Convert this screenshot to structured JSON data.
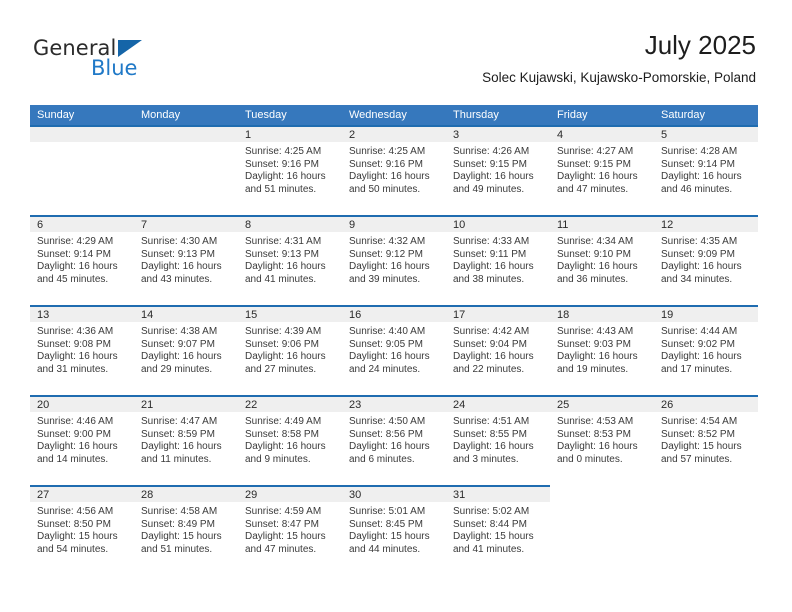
{
  "brand": {
    "name_top": "General",
    "name_bottom": "Blue",
    "accent_color": "#2079c7",
    "triangle_color": "#1565a8"
  },
  "header": {
    "title": "July 2025",
    "subtitle": "Solec Kujawski, Kujawsko-Pomorskie, Poland"
  },
  "theme": {
    "header_row_bg": "#3678bd",
    "row_separator": "#1f6cb0",
    "daynum_band_bg": "#efefef",
    "text_color": "#3a3a3a"
  },
  "weekdays": [
    "Sunday",
    "Monday",
    "Tuesday",
    "Wednesday",
    "Thursday",
    "Friday",
    "Saturday"
  ],
  "labels": {
    "sunrise": "Sunrise:",
    "sunset": "Sunset:",
    "daylight": "Daylight:"
  },
  "weeks": [
    [
      {
        "day": "",
        "empty": true
      },
      {
        "day": "",
        "empty": true
      },
      {
        "day": "1",
        "sunrise": "Sunrise: 4:25 AM",
        "sunset": "Sunset: 9:16 PM",
        "daylight": "Daylight: 16 hours and 51 minutes."
      },
      {
        "day": "2",
        "sunrise": "Sunrise: 4:25 AM",
        "sunset": "Sunset: 9:16 PM",
        "daylight": "Daylight: 16 hours and 50 minutes."
      },
      {
        "day": "3",
        "sunrise": "Sunrise: 4:26 AM",
        "sunset": "Sunset: 9:15 PM",
        "daylight": "Daylight: 16 hours and 49 minutes."
      },
      {
        "day": "4",
        "sunrise": "Sunrise: 4:27 AM",
        "sunset": "Sunset: 9:15 PM",
        "daylight": "Daylight: 16 hours and 47 minutes."
      },
      {
        "day": "5",
        "sunrise": "Sunrise: 4:28 AM",
        "sunset": "Sunset: 9:14 PM",
        "daylight": "Daylight: 16 hours and 46 minutes."
      }
    ],
    [
      {
        "day": "6",
        "sunrise": "Sunrise: 4:29 AM",
        "sunset": "Sunset: 9:14 PM",
        "daylight": "Daylight: 16 hours and 45 minutes."
      },
      {
        "day": "7",
        "sunrise": "Sunrise: 4:30 AM",
        "sunset": "Sunset: 9:13 PM",
        "daylight": "Daylight: 16 hours and 43 minutes."
      },
      {
        "day": "8",
        "sunrise": "Sunrise: 4:31 AM",
        "sunset": "Sunset: 9:13 PM",
        "daylight": "Daylight: 16 hours and 41 minutes."
      },
      {
        "day": "9",
        "sunrise": "Sunrise: 4:32 AM",
        "sunset": "Sunset: 9:12 PM",
        "daylight": "Daylight: 16 hours and 39 minutes."
      },
      {
        "day": "10",
        "sunrise": "Sunrise: 4:33 AM",
        "sunset": "Sunset: 9:11 PM",
        "daylight": "Daylight: 16 hours and 38 minutes."
      },
      {
        "day": "11",
        "sunrise": "Sunrise: 4:34 AM",
        "sunset": "Sunset: 9:10 PM",
        "daylight": "Daylight: 16 hours and 36 minutes."
      },
      {
        "day": "12",
        "sunrise": "Sunrise: 4:35 AM",
        "sunset": "Sunset: 9:09 PM",
        "daylight": "Daylight: 16 hours and 34 minutes."
      }
    ],
    [
      {
        "day": "13",
        "sunrise": "Sunrise: 4:36 AM",
        "sunset": "Sunset: 9:08 PM",
        "daylight": "Daylight: 16 hours and 31 minutes."
      },
      {
        "day": "14",
        "sunrise": "Sunrise: 4:38 AM",
        "sunset": "Sunset: 9:07 PM",
        "daylight": "Daylight: 16 hours and 29 minutes."
      },
      {
        "day": "15",
        "sunrise": "Sunrise: 4:39 AM",
        "sunset": "Sunset: 9:06 PM",
        "daylight": "Daylight: 16 hours and 27 minutes."
      },
      {
        "day": "16",
        "sunrise": "Sunrise: 4:40 AM",
        "sunset": "Sunset: 9:05 PM",
        "daylight": "Daylight: 16 hours and 24 minutes."
      },
      {
        "day": "17",
        "sunrise": "Sunrise: 4:42 AM",
        "sunset": "Sunset: 9:04 PM",
        "daylight": "Daylight: 16 hours and 22 minutes."
      },
      {
        "day": "18",
        "sunrise": "Sunrise: 4:43 AM",
        "sunset": "Sunset: 9:03 PM",
        "daylight": "Daylight: 16 hours and 19 minutes."
      },
      {
        "day": "19",
        "sunrise": "Sunrise: 4:44 AM",
        "sunset": "Sunset: 9:02 PM",
        "daylight": "Daylight: 16 hours and 17 minutes."
      }
    ],
    [
      {
        "day": "20",
        "sunrise": "Sunrise: 4:46 AM",
        "sunset": "Sunset: 9:00 PM",
        "daylight": "Daylight: 16 hours and 14 minutes."
      },
      {
        "day": "21",
        "sunrise": "Sunrise: 4:47 AM",
        "sunset": "Sunset: 8:59 PM",
        "daylight": "Daylight: 16 hours and 11 minutes."
      },
      {
        "day": "22",
        "sunrise": "Sunrise: 4:49 AM",
        "sunset": "Sunset: 8:58 PM",
        "daylight": "Daylight: 16 hours and 9 minutes."
      },
      {
        "day": "23",
        "sunrise": "Sunrise: 4:50 AM",
        "sunset": "Sunset: 8:56 PM",
        "daylight": "Daylight: 16 hours and 6 minutes."
      },
      {
        "day": "24",
        "sunrise": "Sunrise: 4:51 AM",
        "sunset": "Sunset: 8:55 PM",
        "daylight": "Daylight: 16 hours and 3 minutes."
      },
      {
        "day": "25",
        "sunrise": "Sunrise: 4:53 AM",
        "sunset": "Sunset: 8:53 PM",
        "daylight": "Daylight: 16 hours and 0 minutes."
      },
      {
        "day": "26",
        "sunrise": "Sunrise: 4:54 AM",
        "sunset": "Sunset: 8:52 PM",
        "daylight": "Daylight: 15 hours and 57 minutes."
      }
    ],
    [
      {
        "day": "27",
        "sunrise": "Sunrise: 4:56 AM",
        "sunset": "Sunset: 8:50 PM",
        "daylight": "Daylight: 15 hours and 54 minutes."
      },
      {
        "day": "28",
        "sunrise": "Sunrise: 4:58 AM",
        "sunset": "Sunset: 8:49 PM",
        "daylight": "Daylight: 15 hours and 51 minutes."
      },
      {
        "day": "29",
        "sunrise": "Sunrise: 4:59 AM",
        "sunset": "Sunset: 8:47 PM",
        "daylight": "Daylight: 15 hours and 47 minutes."
      },
      {
        "day": "30",
        "sunrise": "Sunrise: 5:01 AM",
        "sunset": "Sunset: 8:45 PM",
        "daylight": "Daylight: 15 hours and 44 minutes."
      },
      {
        "day": "31",
        "sunrise": "Sunrise: 5:02 AM",
        "sunset": "Sunset: 8:44 PM",
        "daylight": "Daylight: 15 hours and 41 minutes."
      },
      {
        "day": "",
        "empty": true
      },
      {
        "day": "",
        "empty": true
      }
    ]
  ]
}
